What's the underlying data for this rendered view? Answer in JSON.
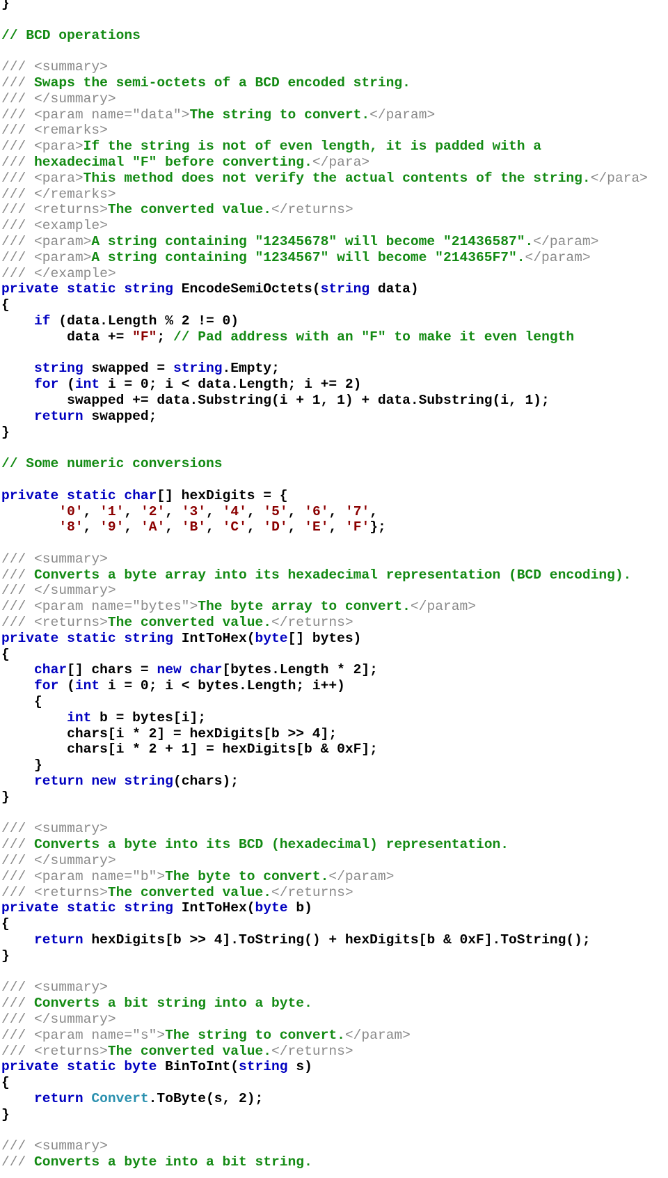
{
  "colors": {
    "keyword": "#0000c0",
    "comment": "#138a13",
    "doc_tag": "#8a8a8a",
    "string": "#8b0000",
    "type": "#2b91af",
    "plain": "#000000"
  },
  "code_lines": [
    [
      [
        "plain",
        "}"
      ]
    ],
    [],
    [
      [
        "com",
        "// BCD operations"
      ]
    ],
    [],
    [
      [
        "doc",
        "/// <summary>"
      ]
    ],
    [
      [
        "doc",
        "/// "
      ],
      [
        "com",
        "Swaps the semi-octets of a BCD encoded string."
      ]
    ],
    [
      [
        "doc",
        "/// </summary>"
      ]
    ],
    [
      [
        "doc",
        "/// <param name=\"data\">"
      ],
      [
        "com",
        "The string to convert."
      ],
      [
        "doc",
        "</param>"
      ]
    ],
    [
      [
        "doc",
        "/// <remarks>"
      ]
    ],
    [
      [
        "doc",
        "/// <para>"
      ],
      [
        "com",
        "If the string is not of even length, it is padded with a"
      ]
    ],
    [
      [
        "doc",
        "/// "
      ],
      [
        "com",
        "hexadecimal \"F\" before converting."
      ],
      [
        "doc",
        "</para>"
      ]
    ],
    [
      [
        "doc",
        "/// <para>"
      ],
      [
        "com",
        "This method does not verify the actual contents of the string."
      ],
      [
        "doc",
        "</para>"
      ]
    ],
    [
      [
        "doc",
        "/// </remarks>"
      ]
    ],
    [
      [
        "doc",
        "/// <returns>"
      ],
      [
        "com",
        "The converted value."
      ],
      [
        "doc",
        "</returns>"
      ]
    ],
    [
      [
        "doc",
        "/// <example>"
      ]
    ],
    [
      [
        "doc",
        "/// <param>"
      ],
      [
        "com",
        "A string containing \"12345678\" will become \"21436587\"."
      ],
      [
        "doc",
        "</param>"
      ]
    ],
    [
      [
        "doc",
        "/// <param>"
      ],
      [
        "com",
        "A string containing \"1234567\" will become \"214365F7\"."
      ],
      [
        "doc",
        "</param>"
      ]
    ],
    [
      [
        "doc",
        "/// </example>"
      ]
    ],
    [
      [
        "kw",
        "private static string "
      ],
      [
        "plain",
        "EncodeSemiOctets("
      ],
      [
        "kw",
        "string"
      ],
      [
        "plain",
        " data)"
      ]
    ],
    [
      [
        "plain",
        "{"
      ]
    ],
    [
      [
        "plain",
        "    "
      ],
      [
        "kw",
        "if"
      ],
      [
        "plain",
        " (data.Length % 2 != 0)"
      ]
    ],
    [
      [
        "plain",
        "        data += "
      ],
      [
        "str",
        "\"F\""
      ],
      [
        "plain",
        "; "
      ],
      [
        "com",
        "// Pad address with an \"F\" to make it even length"
      ]
    ],
    [],
    [
      [
        "plain",
        "    "
      ],
      [
        "kw",
        "string"
      ],
      [
        "plain",
        " swapped = "
      ],
      [
        "kw",
        "string"
      ],
      [
        "plain",
        ".Empty;"
      ]
    ],
    [
      [
        "plain",
        "    "
      ],
      [
        "kw",
        "for"
      ],
      [
        "plain",
        " ("
      ],
      [
        "kw",
        "int"
      ],
      [
        "plain",
        " i = 0; i < data.Length; i += 2)"
      ]
    ],
    [
      [
        "plain",
        "        swapped += data.Substring(i + 1, 1) + data.Substring(i, 1);"
      ]
    ],
    [
      [
        "plain",
        "    "
      ],
      [
        "kw",
        "return"
      ],
      [
        "plain",
        " swapped;"
      ]
    ],
    [
      [
        "plain",
        "}"
      ]
    ],
    [],
    [
      [
        "com",
        "// Some numeric conversions"
      ]
    ],
    [],
    [
      [
        "kw",
        "private static char"
      ],
      [
        "plain",
        "[] hexDigits = {"
      ]
    ],
    [
      [
        "plain",
        "       "
      ],
      [
        "str",
        "'0'"
      ],
      [
        "plain",
        ", "
      ],
      [
        "str",
        "'1'"
      ],
      [
        "plain",
        ", "
      ],
      [
        "str",
        "'2'"
      ],
      [
        "plain",
        ", "
      ],
      [
        "str",
        "'3'"
      ],
      [
        "plain",
        ", "
      ],
      [
        "str",
        "'4'"
      ],
      [
        "plain",
        ", "
      ],
      [
        "str",
        "'5'"
      ],
      [
        "plain",
        ", "
      ],
      [
        "str",
        "'6'"
      ],
      [
        "plain",
        ", "
      ],
      [
        "str",
        "'7'"
      ],
      [
        "plain",
        ","
      ]
    ],
    [
      [
        "plain",
        "       "
      ],
      [
        "str",
        "'8'"
      ],
      [
        "plain",
        ", "
      ],
      [
        "str",
        "'9'"
      ],
      [
        "plain",
        ", "
      ],
      [
        "str",
        "'A'"
      ],
      [
        "plain",
        ", "
      ],
      [
        "str",
        "'B'"
      ],
      [
        "plain",
        ", "
      ],
      [
        "str",
        "'C'"
      ],
      [
        "plain",
        ", "
      ],
      [
        "str",
        "'D'"
      ],
      [
        "plain",
        ", "
      ],
      [
        "str",
        "'E'"
      ],
      [
        "plain",
        ", "
      ],
      [
        "str",
        "'F'"
      ],
      [
        "plain",
        "};"
      ]
    ],
    [],
    [
      [
        "doc",
        "/// <summary>"
      ]
    ],
    [
      [
        "doc",
        "/// "
      ],
      [
        "com",
        "Converts a byte array into its hexadecimal representation (BCD encoding)."
      ]
    ],
    [
      [
        "doc",
        "/// </summary>"
      ]
    ],
    [
      [
        "doc",
        "/// <param name=\"bytes\">"
      ],
      [
        "com",
        "The byte array to convert."
      ],
      [
        "doc",
        "</param>"
      ]
    ],
    [
      [
        "doc",
        "/// <returns>"
      ],
      [
        "com",
        "The converted value."
      ],
      [
        "doc",
        "</returns>"
      ]
    ],
    [
      [
        "kw",
        "private static string "
      ],
      [
        "plain",
        "IntToHex("
      ],
      [
        "kw",
        "byte"
      ],
      [
        "plain",
        "[] bytes)"
      ]
    ],
    [
      [
        "plain",
        "{"
      ]
    ],
    [
      [
        "plain",
        "    "
      ],
      [
        "kw",
        "char"
      ],
      [
        "plain",
        "[] chars = "
      ],
      [
        "kw",
        "new char"
      ],
      [
        "plain",
        "[bytes.Length * 2];"
      ]
    ],
    [
      [
        "plain",
        "    "
      ],
      [
        "kw",
        "for"
      ],
      [
        "plain",
        " ("
      ],
      [
        "kw",
        "int"
      ],
      [
        "plain",
        " i = 0; i < bytes.Length; i++)"
      ]
    ],
    [
      [
        "plain",
        "    {"
      ]
    ],
    [
      [
        "plain",
        "        "
      ],
      [
        "kw",
        "int"
      ],
      [
        "plain",
        " b = bytes[i];"
      ]
    ],
    [
      [
        "plain",
        "        chars[i * 2] = hexDigits[b >> 4];"
      ]
    ],
    [
      [
        "plain",
        "        chars[i * 2 + 1] = hexDigits[b & 0xF];"
      ]
    ],
    [
      [
        "plain",
        "    }"
      ]
    ],
    [
      [
        "plain",
        "    "
      ],
      [
        "kw",
        "return new string"
      ],
      [
        "plain",
        "(chars);"
      ]
    ],
    [
      [
        "plain",
        "}"
      ]
    ],
    [],
    [
      [
        "doc",
        "/// <summary>"
      ]
    ],
    [
      [
        "doc",
        "/// "
      ],
      [
        "com",
        "Converts a byte into its BCD (hexadecimal) representation."
      ]
    ],
    [
      [
        "doc",
        "/// </summary>"
      ]
    ],
    [
      [
        "doc",
        "/// <param name=\"b\">"
      ],
      [
        "com",
        "The byte to convert."
      ],
      [
        "doc",
        "</param>"
      ]
    ],
    [
      [
        "doc",
        "/// <returns>"
      ],
      [
        "com",
        "The converted value."
      ],
      [
        "doc",
        "</returns>"
      ]
    ],
    [
      [
        "kw",
        "private static string "
      ],
      [
        "plain",
        "IntToHex("
      ],
      [
        "kw",
        "byte"
      ],
      [
        "plain",
        " b)"
      ]
    ],
    [
      [
        "plain",
        "{"
      ]
    ],
    [
      [
        "plain",
        "    "
      ],
      [
        "kw",
        "return"
      ],
      [
        "plain",
        " hexDigits[b >> 4].ToString() + hexDigits[b & 0xF].ToString();"
      ]
    ],
    [
      [
        "plain",
        "}"
      ]
    ],
    [],
    [
      [
        "doc",
        "/// <summary>"
      ]
    ],
    [
      [
        "doc",
        "/// "
      ],
      [
        "com",
        "Converts a bit string into a byte."
      ]
    ],
    [
      [
        "doc",
        "/// </summary>"
      ]
    ],
    [
      [
        "doc",
        "/// <param name=\"s\">"
      ],
      [
        "com",
        "The string to convert."
      ],
      [
        "doc",
        "</param>"
      ]
    ],
    [
      [
        "doc",
        "/// <returns>"
      ],
      [
        "com",
        "The converted value."
      ],
      [
        "doc",
        "</returns>"
      ]
    ],
    [
      [
        "kw",
        "private static byte "
      ],
      [
        "plain",
        "BinToInt("
      ],
      [
        "kw",
        "string"
      ],
      [
        "plain",
        " s)"
      ]
    ],
    [
      [
        "plain",
        "{"
      ]
    ],
    [
      [
        "plain",
        "    "
      ],
      [
        "kw",
        "return "
      ],
      [
        "type",
        "Convert"
      ],
      [
        "plain",
        ".ToByte(s, 2);"
      ]
    ],
    [
      [
        "plain",
        "}"
      ]
    ],
    [],
    [
      [
        "doc",
        "/// <summary>"
      ]
    ],
    [
      [
        "doc",
        "/// "
      ],
      [
        "com",
        "Converts a byte into a bit string."
      ]
    ]
  ]
}
